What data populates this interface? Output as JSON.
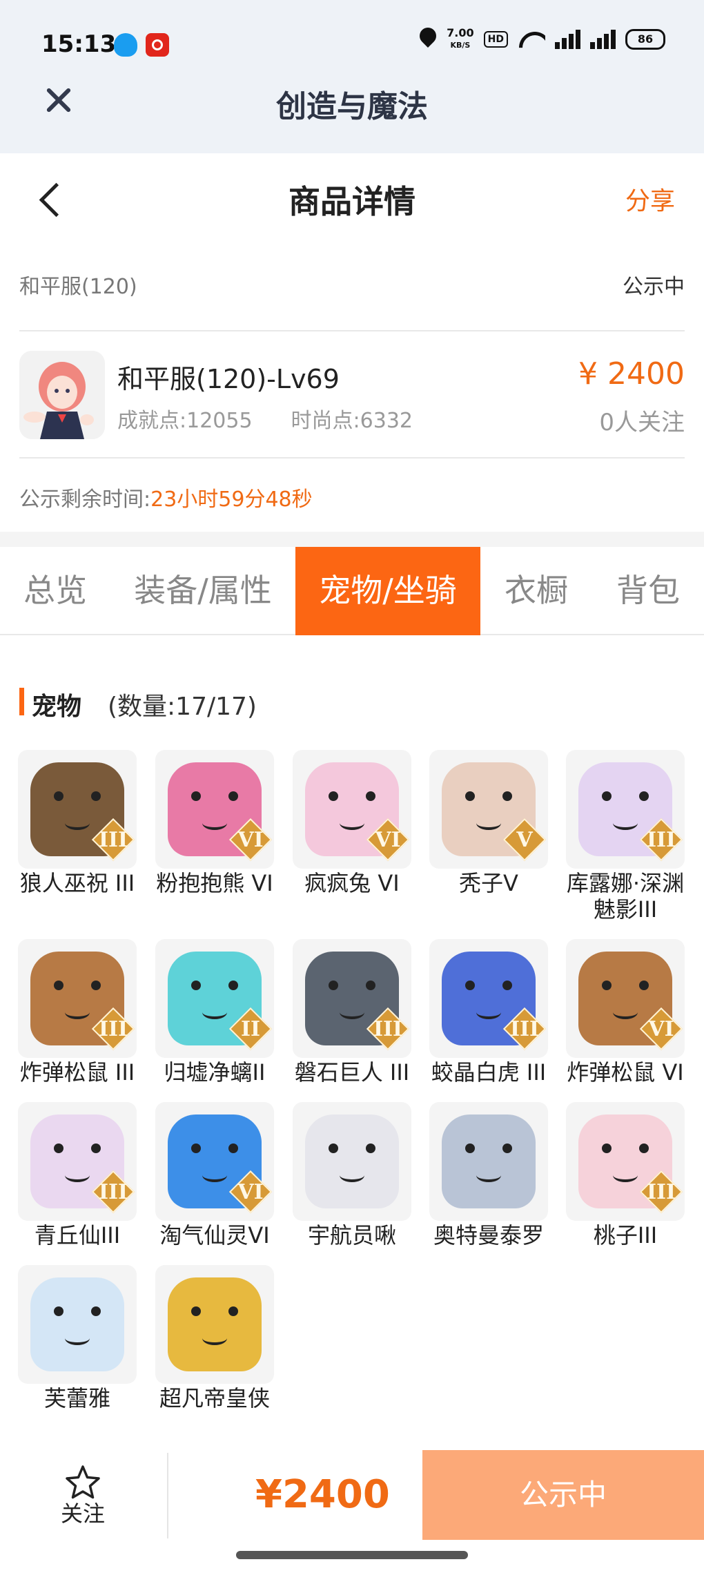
{
  "status_bar": {
    "time": "15:13",
    "speed_value": "7.00",
    "speed_unit": "KB/S",
    "hd_label": "HD",
    "battery": "86",
    "icons": [
      "qq-icon",
      "app-red-icon",
      "location-icon",
      "hd-icon",
      "wifi-icon",
      "signal-icon",
      "signal-icon",
      "battery-icon"
    ]
  },
  "app_bar": {
    "title": "创造与魔法",
    "close_icon": "close-icon"
  },
  "header": {
    "title": "商品详情",
    "share_label": "分享",
    "back_icon": "back-icon"
  },
  "server": {
    "name": "和平服(120)",
    "status": "公示中"
  },
  "item": {
    "name": "和平服(120)-Lv69",
    "achievement": "成就点:12055",
    "fashion": "时尚点:6332",
    "price": "¥ 2400",
    "followers": "0人关注"
  },
  "remaining": {
    "label": "公示剩余时间:",
    "value": "23小时59分48秒"
  },
  "tabs": [
    {
      "label": "总览",
      "active": false
    },
    {
      "label": "装备/属性",
      "active": false
    },
    {
      "label": "宠物/坐骑",
      "active": true
    },
    {
      "label": "衣橱",
      "active": false
    },
    {
      "label": "背包",
      "active": false
    }
  ],
  "pets_section": {
    "label": "宠物",
    "count": "(数量:17/17)"
  },
  "pets": [
    {
      "name": "狼人巫祝 III",
      "rank": "III",
      "color": "#7a5a3a"
    },
    {
      "name": "粉抱抱熊 VI",
      "rank": "VI",
      "color": "#e87aa6"
    },
    {
      "name": "疯疯兔 VI",
      "rank": "VI",
      "color": "#f4c8dc"
    },
    {
      "name": "秃子V",
      "rank": "V",
      "color": "#e9cfc0"
    },
    {
      "name": "库露娜·深渊魅影III",
      "rank": "III",
      "color": "#e4d4f2"
    },
    {
      "name": "炸弹松鼠 III",
      "rank": "III",
      "color": "#b77a45"
    },
    {
      "name": "归墟净螭II",
      "rank": "II",
      "color": "#5ed2d8"
    },
    {
      "name": "磐石巨人 III",
      "rank": "III",
      "color": "#5b6470"
    },
    {
      "name": "蛟晶白虎 III",
      "rank": "III",
      "color": "#4f6fd8"
    },
    {
      "name": "炸弹松鼠 VI",
      "rank": "VI",
      "color": "#b77a45"
    },
    {
      "name": "青丘仙III",
      "rank": "III",
      "color": "#ead8f0"
    },
    {
      "name": "淘气仙灵VI",
      "rank": "VI",
      "color": "#3d8fe8"
    },
    {
      "name": "宇航员啾",
      "rank": "",
      "color": "#e6e6ec"
    },
    {
      "name": "奥特曼泰罗",
      "rank": "",
      "color": "#b9c4d6"
    },
    {
      "name": "桃子III",
      "rank": "III",
      "color": "#f6d2da"
    },
    {
      "name": "芙蕾雅",
      "rank": "",
      "color": "#d4e6f6"
    },
    {
      "name": "超凡帝皇侠",
      "rank": "",
      "color": "#e7b93f"
    }
  ],
  "bottom_bar": {
    "follow_label": "关注",
    "price": "¥2400",
    "action_label": "公示中",
    "star_icon": "star-icon"
  }
}
